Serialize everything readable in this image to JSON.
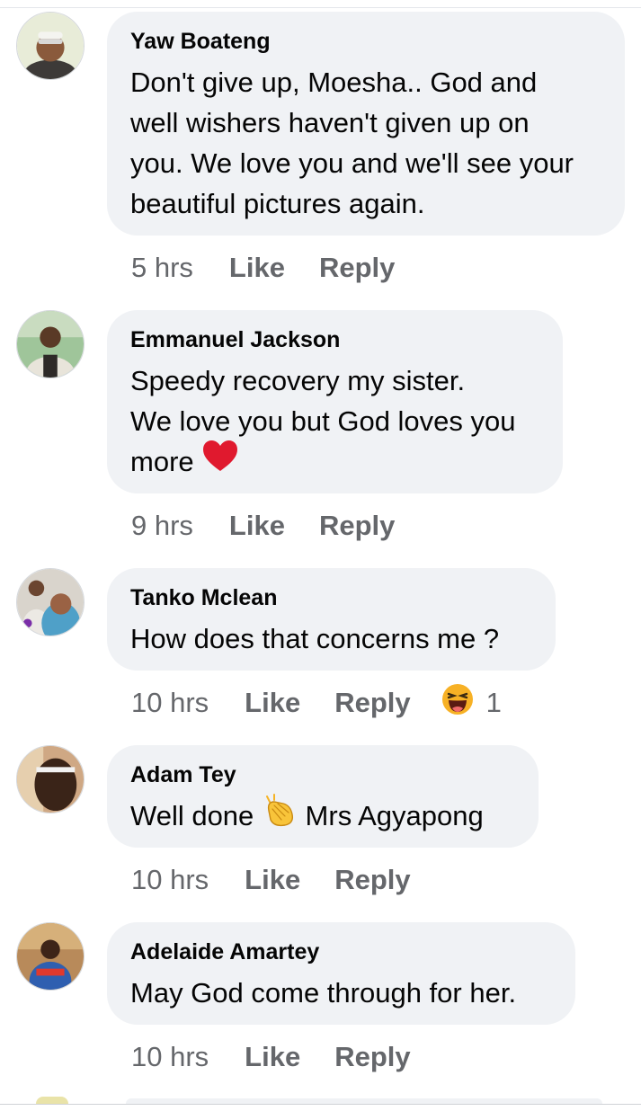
{
  "comments": [
    {
      "author": "Yaw Boateng",
      "lines": [
        "Don't give up, Moesha.. God and",
        "well wishers haven't given up on",
        "you. We love you and we'll see your",
        "beautiful pictures again."
      ],
      "time": "5 hrs",
      "like": "Like",
      "reply": "Reply"
    },
    {
      "author": "Emmanuel Jackson",
      "lines": [
        "Speedy recovery my sister.",
        "We love you but God loves you",
        "more"
      ],
      "emoji": "heart-icon",
      "time": "9 hrs",
      "like": "Like",
      "reply": "Reply"
    },
    {
      "author": "Tanko Mclean",
      "lines": [
        "How does that concerns me ?"
      ],
      "time": "10 hrs",
      "like": "Like",
      "reply": "Reply",
      "reaction": {
        "icon": "haha-reaction-icon",
        "count": "1"
      }
    },
    {
      "author": "Adam Tey",
      "text_before": "Well done",
      "emoji": "clapping-hands-icon",
      "text_after": "Mrs Agyapong",
      "time": "10 hrs",
      "like": "Like",
      "reply": "Reply"
    },
    {
      "author": "Adelaide Amartey",
      "lines": [
        "May God come through for her."
      ],
      "time": "10 hrs",
      "like": "Like",
      "reply": "Reply"
    }
  ],
  "colors": {
    "bubble": "#f0f2f5",
    "author": "#050505",
    "meta": "#65676b",
    "heart": "#e0192e",
    "haha": "#f7b125"
  }
}
